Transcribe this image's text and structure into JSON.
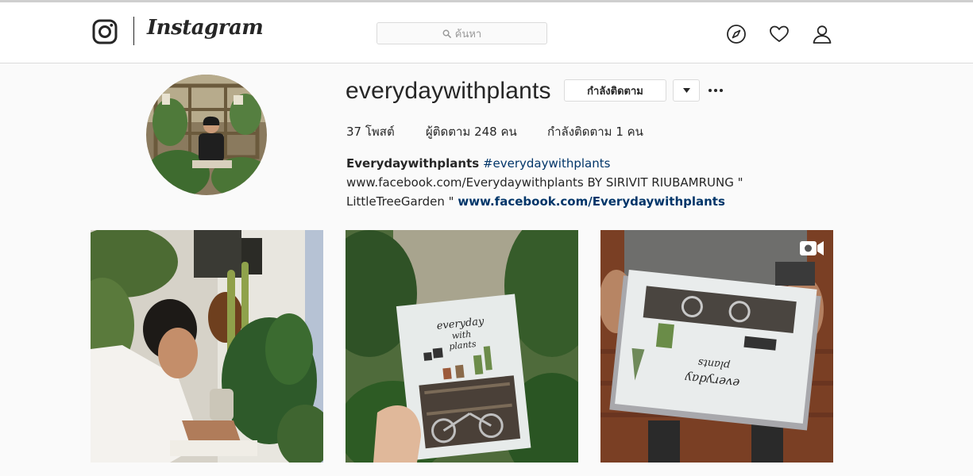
{
  "header": {
    "logo_text": "Instagram",
    "search": {
      "placeholder": "ค้นหา",
      "icon": "search-icon"
    },
    "nav": [
      "explore-compass-icon",
      "activity-heart-icon",
      "profile-person-icon"
    ]
  },
  "profile": {
    "username": "everydaywithplants",
    "follow_button": "กำลังติดตาม",
    "dropdown_icon": "caret-down-icon",
    "more_icon": "more-options-icon",
    "stats": {
      "posts": "37 โพสต์",
      "followers": "ผู้ติดตาม 248 คน",
      "following": "กำลังติดตาม 1 คน"
    },
    "bio": {
      "name": "Everydaywithplants",
      "hashtag": "#everydaywithplants",
      "text": "www.facebook.com/Everydaywithplants BY SIRIVIT RIUBAMRUNG \" LittleTreeGarden \"",
      "link": "www.facebook.com/Everydaywithplants"
    }
  },
  "posts": [
    {
      "type": "photo"
    },
    {
      "type": "photo",
      "book_title": "everyday with plants"
    },
    {
      "type": "video",
      "badge_icon": "video-camera-icon",
      "book_title": "everyday with plants"
    }
  ],
  "colors": {
    "background": "#fafafa",
    "header_bg": "#ffffff",
    "border": "#dbdbdb",
    "text": "#262626",
    "link": "#003569"
  }
}
